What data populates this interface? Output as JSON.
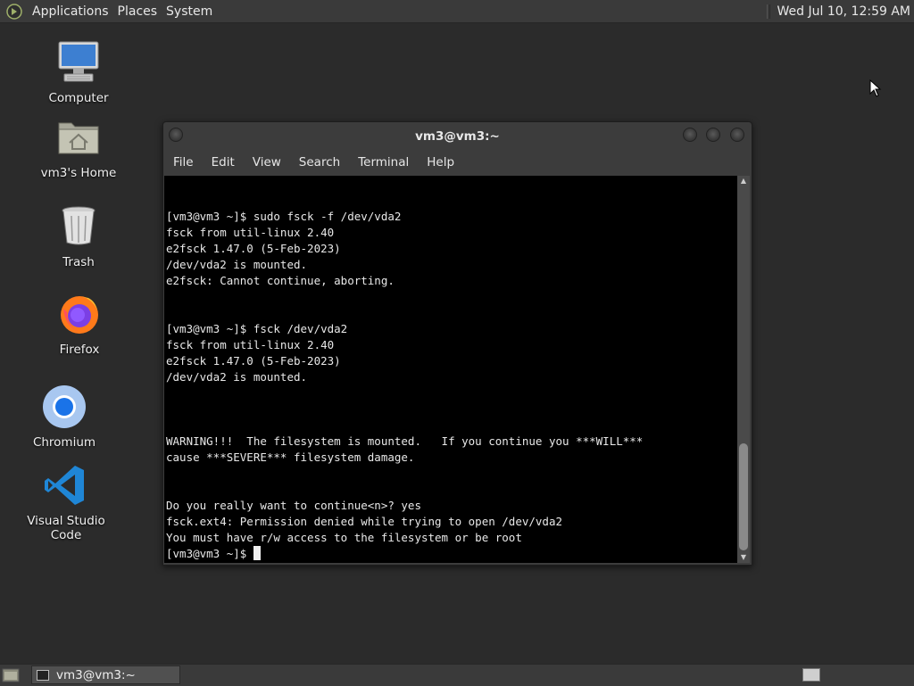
{
  "top_panel": {
    "menus": [
      "Applications",
      "Places",
      "System"
    ],
    "clock": "Wed Jul 10, 12:59 AM"
  },
  "desktop_icons": [
    {
      "label": "Computer",
      "icon": "computer-icon"
    },
    {
      "label": "vm3's Home",
      "icon": "home-folder-icon"
    },
    {
      "label": "Trash",
      "icon": "trash-icon"
    },
    {
      "label": "Firefox",
      "icon": "firefox-icon"
    },
    {
      "label": "Chromium",
      "icon": "chromium-icon"
    },
    {
      "label": "Visual Studio Code",
      "icon": "vscode-icon"
    }
  ],
  "window": {
    "title": "vm3@vm3:~",
    "menus": [
      "File",
      "Edit",
      "View",
      "Search",
      "Terminal",
      "Help"
    ]
  },
  "terminal": {
    "lines": [
      "",
      "",
      "[vm3@vm3 ~]$ sudo fsck -f /dev/vda2",
      "fsck from util-linux 2.40",
      "e2fsck 1.47.0 (5-Feb-2023)",
      "/dev/vda2 is mounted.",
      "e2fsck: Cannot continue, aborting.",
      "",
      "",
      "[vm3@vm3 ~]$ fsck /dev/vda2",
      "fsck from util-linux 2.40",
      "e2fsck 1.47.0 (5-Feb-2023)",
      "/dev/vda2 is mounted.",
      "",
      "",
      "",
      "WARNING!!!  The filesystem is mounted.   If you continue you ***WILL***",
      "cause ***SEVERE*** filesystem damage.",
      "",
      "",
      "Do you really want to continue<n>? yes",
      "fsck.ext4: Permission denied while trying to open /dev/vda2",
      "You must have r/w access to the filesystem or be root"
    ],
    "prompt": "[vm3@vm3 ~]$ "
  },
  "taskbar": {
    "task_label": "vm3@vm3:~"
  }
}
